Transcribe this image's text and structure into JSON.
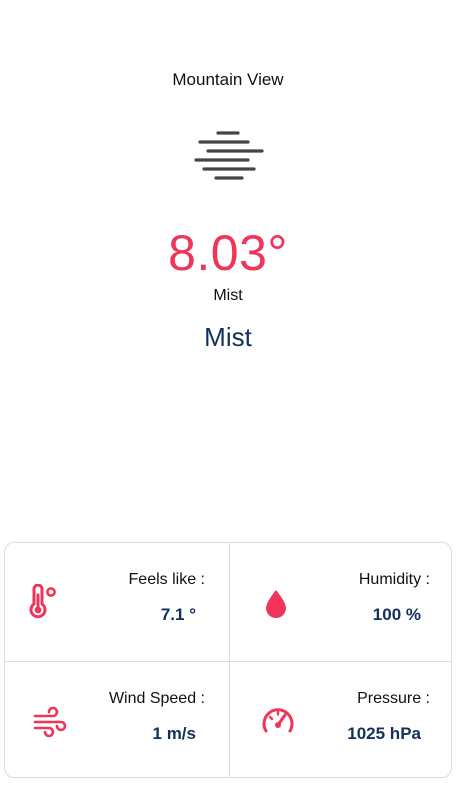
{
  "location": {
    "city": "Mountain View"
  },
  "current": {
    "condition_icon": "mist-icon",
    "temperature": "8.03°",
    "condition_main": "Mist",
    "condition_description": "Mist"
  },
  "details": {
    "feels_like": {
      "label": "Feels like :",
      "value": "7.1 °",
      "icon": "thermometer-icon"
    },
    "humidity": {
      "label": "Humidity :",
      "value": "100 %",
      "icon": "water-drop-icon"
    },
    "wind_speed": {
      "label": "Wind Speed :",
      "value": "1 m/s",
      "icon": "wind-icon"
    },
    "pressure": {
      "label": "Pressure :",
      "value": "1025 hPa",
      "icon": "gauge-icon"
    }
  },
  "colors": {
    "accent": "#f0345a",
    "primary_text": "#12305a",
    "icon_gray": "#444444",
    "divider": "#dcdcdc"
  }
}
